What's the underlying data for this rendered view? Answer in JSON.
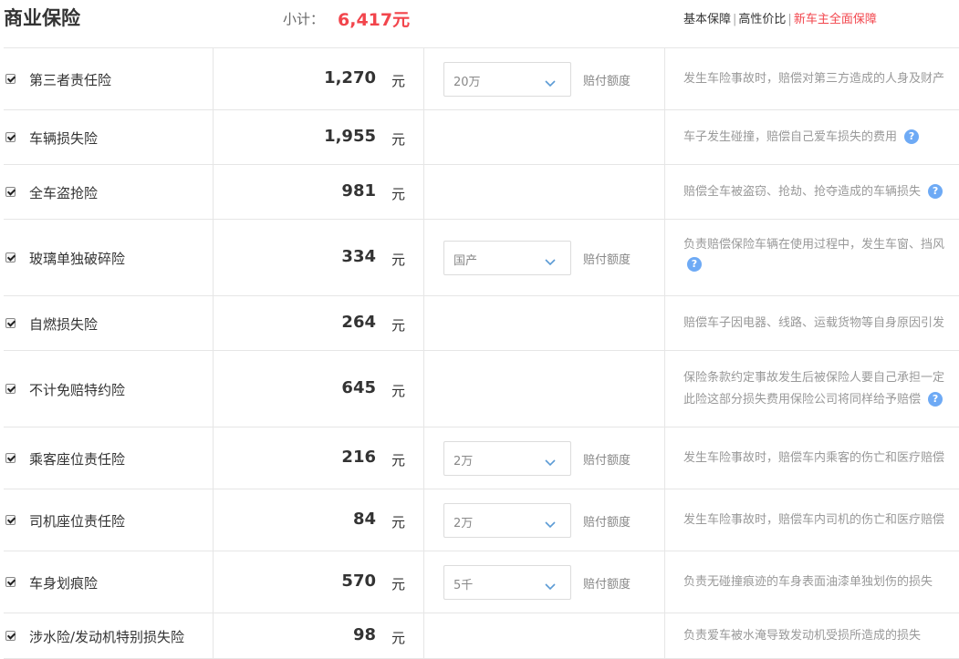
{
  "header": {
    "title": "商业保险",
    "subtotal_label": "小计：",
    "subtotal_value": "6,417元",
    "plans": [
      {
        "label": "基本保障",
        "active": false
      },
      {
        "label": "高性价比",
        "active": false
      },
      {
        "label": "新车主全面保障",
        "active": true
      }
    ],
    "plan_sep": "|"
  },
  "unit": "元",
  "option_label": "赔付额度",
  "help_glyph": "?",
  "rows": [
    {
      "name": "第三者责任险",
      "price": "1,270",
      "option": "20万",
      "desc": [
        "发生车险事故时，赔偿对第三方造成的人身及财产"
      ]
    },
    {
      "name": "车辆损失险",
      "price": "1,955",
      "desc": [
        "车子发生碰撞，赔偿自己爱车损失的费用"
      ],
      "help": true
    },
    {
      "name": "全车盗抢险",
      "price": "981",
      "desc": [
        "赔偿全车被盗窃、抢劫、抢夺造成的车辆损失"
      ],
      "help": true
    },
    {
      "name": "玻璃单独破碎险",
      "price": "334",
      "option": "国产",
      "desc": [
        "负责赔偿保险车辆在使用过程中，发生车窗、挡风"
      ],
      "help_block": true
    },
    {
      "name": "自燃损失险",
      "price": "264",
      "desc": [
        "赔偿车子因电器、线路、运载货物等自身原因引发"
      ]
    },
    {
      "name": "不计免赔特约险",
      "price": "645",
      "desc": [
        "保险条款约定事故发生后被保险人要自己承担一定",
        "此险这部分损失费用保险公司将同样给予赔偿"
      ],
      "help": true
    },
    {
      "name": "乘客座位责任险",
      "price": "216",
      "option": "2万",
      "desc": [
        "发生车险事故时，赔偿车内乘客的伤亡和医疗赔偿"
      ]
    },
    {
      "name": "司机座位责任险",
      "price": "84",
      "option": "2万",
      "desc": [
        "发生车险事故时，赔偿车内司机的伤亡和医疗赔偿"
      ]
    },
    {
      "name": "车身划痕险",
      "price": "570",
      "option": "5千",
      "desc": [
        "负责无碰撞痕迹的车身表面油漆单独划伤的损失"
      ]
    },
    {
      "name": "涉水险/发动机特别损失险",
      "price": "98",
      "desc": [
        "负责爱车被水淹导致发动机受损所造成的损失"
      ]
    }
  ]
}
